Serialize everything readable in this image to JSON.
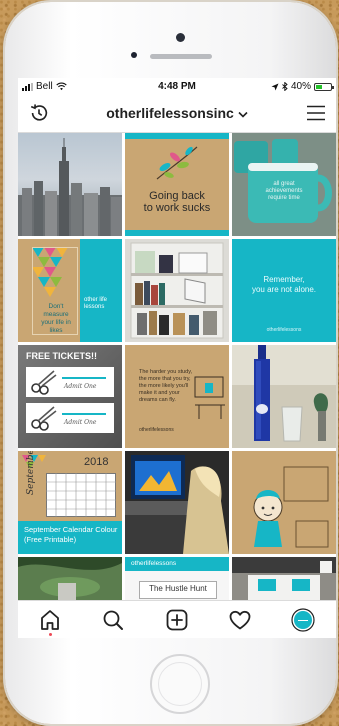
{
  "status_bar": {
    "carrier": "Bell",
    "time": "4:48 PM",
    "battery": "40%"
  },
  "header": {
    "username": "otherlifelessonsinc",
    "icons": [
      "history-icon",
      "chevron-down-icon",
      "menu-icon"
    ]
  },
  "posts": {
    "p1": {
      "kind": "photo",
      "subject": "city skyline"
    },
    "p2": {
      "line1": "Going back",
      "line2": "to work sucks"
    },
    "p3": {
      "mug_text": "all great achievements require time"
    },
    "p4": {
      "text": "Don't measure your life in likes",
      "logo": "other life lessons"
    },
    "p5": {
      "kind": "photo",
      "subject": "bookshelf"
    },
    "p6": {
      "line1": "Remember,",
      "line2": "you are not alone.",
      "logo": "otherlifelessons"
    },
    "p7": {
      "title": "FREE TICKETS!!",
      "ticket_label": "Admit One"
    },
    "p8": {
      "text": "The harder you study, the more that you try, the more likely you'll make it and your dreams can fly.",
      "logo": "otherlifelessons"
    },
    "p9": {
      "kind": "photo",
      "subject": "water bottle and glass"
    },
    "p10": {
      "month": "September",
      "year": "2018",
      "caption": "September Calendar Colour (Free Printable)"
    },
    "p11": {
      "kind": "photo",
      "subject": "arcade game"
    },
    "p12": {
      "kind": "illustration",
      "subject": "cartoon character"
    },
    "p13": {
      "kind": "photo",
      "subject": "plant"
    },
    "p14": {
      "site_logo": "otherlifelessons",
      "title": "The Hustle Hunt"
    },
    "p15": {
      "kind": "photo",
      "subject": "display board"
    }
  },
  "colors": {
    "teal": "#16b6c6",
    "kraft": "#c9a673",
    "accent_red": "#ed4956"
  },
  "tabbar": {
    "tabs": [
      "home-icon",
      "search-icon",
      "add-post-icon",
      "activity-heart-icon",
      "profile-avatar"
    ]
  }
}
